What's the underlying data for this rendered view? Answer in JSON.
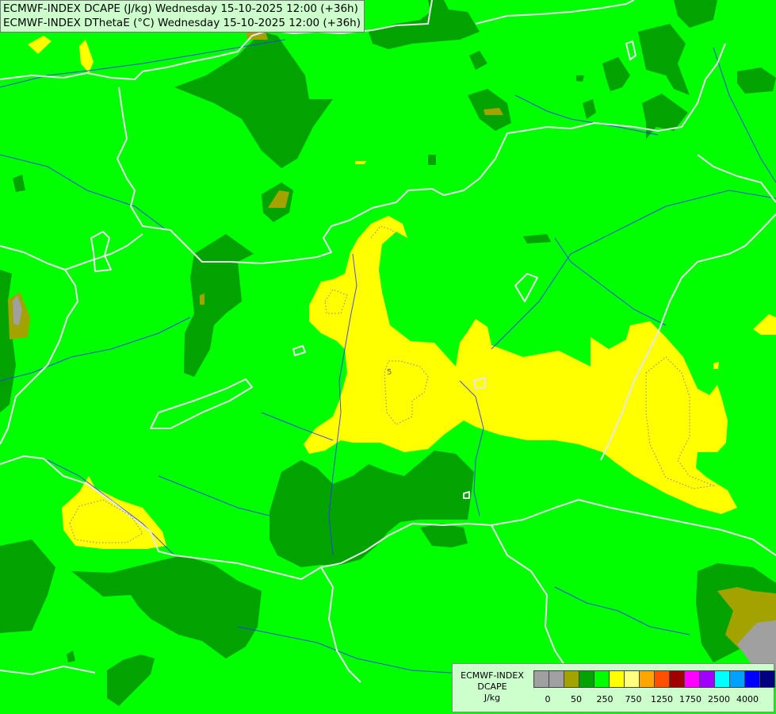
{
  "header": {
    "line1": "ECMWF-INDEX DCAPE (J/kg) Wednesday 15-10-2025 12:00 (+36h)",
    "line2": "ECMWF-INDEX DThetaE (°C) Wednesday 15-10-2025 12:00 (+36h)"
  },
  "map": {
    "contour_label": "5",
    "colors": {
      "light_green": "#00ff00",
      "dark_green": "#00a300",
      "yellow": "#ffff00",
      "olive": "#a3a300",
      "gray": "#a0a0a0",
      "borders": "#e8e8e8",
      "rivers": "#3333ff"
    }
  },
  "legend": {
    "title": [
      "ECMWF-INDEX",
      "DCAPE",
      "J/kg"
    ],
    "colors": [
      "#a0a0a0",
      "#a0a0a0",
      "#a3a300",
      "#00a300",
      "#00ff00",
      "#ffff00",
      "#ffff80",
      "#ffa500",
      "#ff5000",
      "#a00000",
      "#ff00ff",
      "#a000ff",
      "#00ffff",
      "#00a0ff",
      "#0000ff",
      "#000080"
    ],
    "ticks": [
      "0",
      "50",
      "250",
      "750",
      "1250",
      "1750",
      "2500",
      "4000"
    ]
  }
}
